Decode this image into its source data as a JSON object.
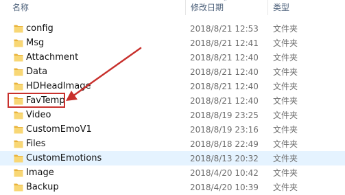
{
  "columns": {
    "name": "名称",
    "modified": "修改日期",
    "type": "类型"
  },
  "colors": {
    "selected_row": "#e5f3ff",
    "annotation": "#c8302c",
    "folder": "#f3c54d"
  },
  "rows": [
    {
      "name": "config",
      "modified": "2018/8/21 12:53",
      "type": "文件夹",
      "selected": false
    },
    {
      "name": "Msg",
      "modified": "2018/8/21 12:41",
      "type": "文件夹",
      "selected": false
    },
    {
      "name": "Attachment",
      "modified": "2018/8/21 12:40",
      "type": "文件夹",
      "selected": false
    },
    {
      "name": "Data",
      "modified": "2018/8/21 12:40",
      "type": "文件夹",
      "selected": false
    },
    {
      "name": "HDHeadImage",
      "modified": "2018/8/21 12:40",
      "type": "文件夹",
      "selected": false
    },
    {
      "name": "FavTemp",
      "modified": "2018/8/21 12:40",
      "type": "文件夹",
      "selected": false,
      "highlighted": true
    },
    {
      "name": "Video",
      "modified": "2018/8/19 23:25",
      "type": "文件夹",
      "selected": false
    },
    {
      "name": "CustomEmoV1",
      "modified": "2018/8/19 23:16",
      "type": "文件夹",
      "selected": false
    },
    {
      "name": "Files",
      "modified": "2018/8/18 22:49",
      "type": "文件夹",
      "selected": false
    },
    {
      "name": "CustomEmotions",
      "modified": "2018/8/13 20:32",
      "type": "文件夹",
      "selected": true
    },
    {
      "name": "Image",
      "modified": "2018/4/20 10:42",
      "type": "文件夹",
      "selected": false
    },
    {
      "name": "Backup",
      "modified": "2018/4/20 10:39",
      "type": "文件夹",
      "selected": false
    }
  ]
}
